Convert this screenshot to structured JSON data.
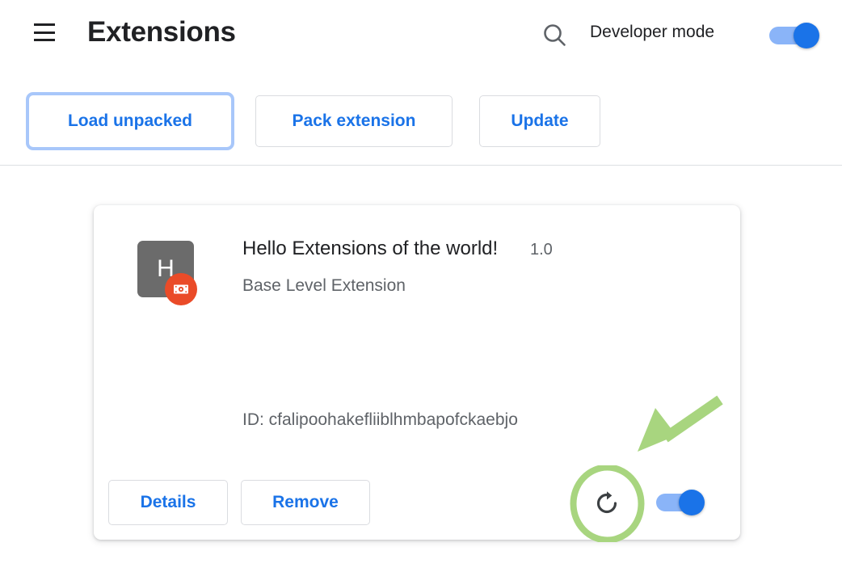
{
  "header": {
    "menu_icon": "hamburger-menu-icon",
    "title": "Extensions",
    "search_icon": "search-icon",
    "developer_mode_label": "Developer mode",
    "developer_mode_on": true
  },
  "toolbar": {
    "load_unpacked_label": "Load unpacked",
    "pack_extension_label": "Pack extension",
    "update_label": "Update",
    "focused_button": "Load unpacked"
  },
  "extension": {
    "icon_letter": "H",
    "unpacked_badge_icon": "unpacked-extension-badge-icon",
    "name": "Hello Extensions of the world!",
    "version": "1.0",
    "description": "Base Level Extension",
    "id_label": "ID: cfalipoohakefliiblhmbapofckaebjo",
    "details_label": "Details",
    "remove_label": "Remove",
    "reload_icon": "reload-icon",
    "enabled": true
  },
  "annotations": {
    "ellipse_target": "reload-icon",
    "arrow_target": "reload-icon",
    "color": "#a8d57f"
  },
  "colors": {
    "accent_blue": "#1a73e8",
    "toggle_track": "#8ab4f8",
    "focus_ring": "#a8c7fa",
    "text_primary": "#202124",
    "text_secondary": "#5f6368",
    "border": "#dadce0",
    "badge_orange": "#ea4b28",
    "icon_gray": "#6b6b6b",
    "annotation_green": "#a8d57f",
    "background": "#ffffff"
  }
}
